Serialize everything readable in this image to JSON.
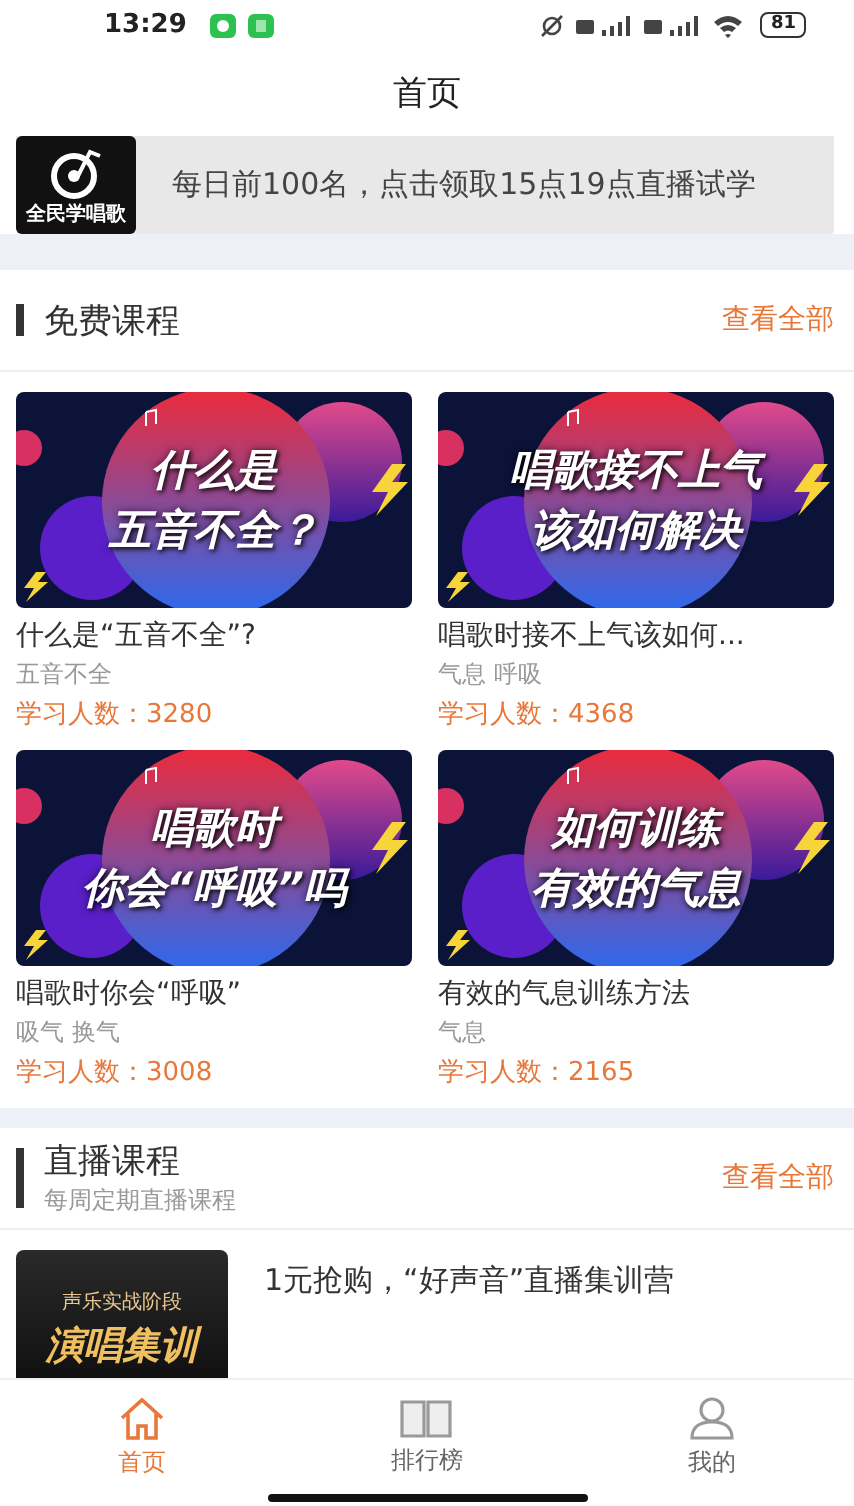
{
  "status_bar": {
    "time": "13:29",
    "battery": "81"
  },
  "header": {
    "title": "首页"
  },
  "banner": {
    "logo_text": "全民学唱歌",
    "text": "每日前100名，点击领取15点19点直播试学"
  },
  "free_courses": {
    "title": "免费课程",
    "more": "查看全部",
    "courses": [
      {
        "cover_lines": [
          "什么是",
          "五音不全？"
        ],
        "title": "什么是“五音不全”?",
        "tags": "五音不全",
        "learners": "学习人数：3280"
      },
      {
        "cover_lines": [
          "唱歌接不上气",
          "该如何解决"
        ],
        "title": "唱歌时接不上气该如何...",
        "tags": "气息 呼吸",
        "learners": "学习人数：4368"
      },
      {
        "cover_lines": [
          "唱歌时",
          "你会“呼吸”吗"
        ],
        "title": "唱歌时你会“呼吸”",
        "tags": "吸气 换气",
        "learners": "学习人数：3008"
      },
      {
        "cover_lines": [
          "如何训练",
          "有效的气息"
        ],
        "title": "有效的气息训练方法",
        "tags": "气息",
        "learners": "学习人数：2165"
      }
    ]
  },
  "live_courses": {
    "title": "直播课程",
    "subtitle": "每周定期直播课程",
    "more": "查看全部",
    "items": [
      {
        "cover_top": "声乐实战阶段",
        "cover_title": "演唱集训",
        "title": "1元抢购，“好声音”直播集训营"
      }
    ]
  },
  "tabs": [
    {
      "label": "首页",
      "selected": true
    },
    {
      "label": "排行榜",
      "selected": false
    },
    {
      "label": "我的",
      "selected": false
    }
  ]
}
